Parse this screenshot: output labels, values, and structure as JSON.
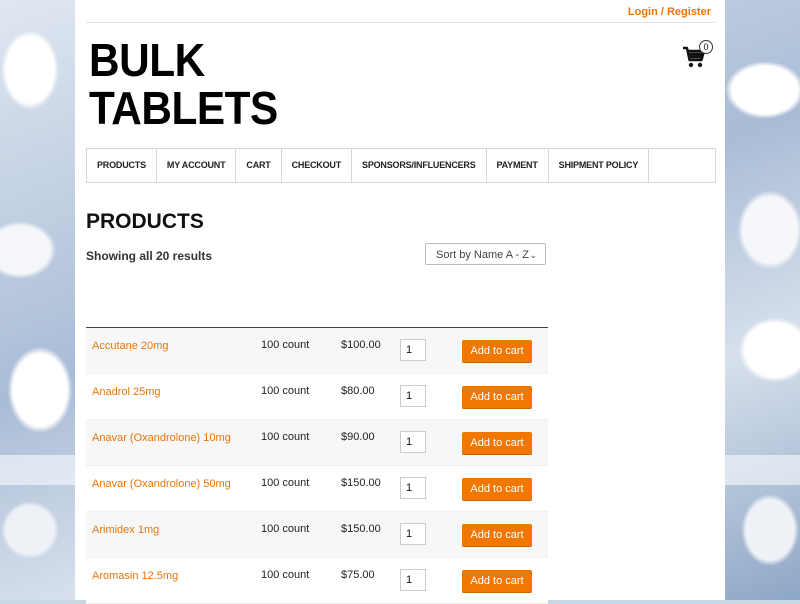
{
  "header": {
    "login_label": "Login / Register",
    "logo_line1": "BULK",
    "logo_line2": "TABLETS",
    "cart_count": "0"
  },
  "nav": {
    "items": [
      {
        "label": "PRODUCTS"
      },
      {
        "label": "MY ACCOUNT"
      },
      {
        "label": "CART"
      },
      {
        "label": "CHECKOUT"
      },
      {
        "label": "SPONSORS/INFLUENCERS"
      },
      {
        "label": "PAYMENT"
      },
      {
        "label": "SHIPMENT POLICY"
      }
    ]
  },
  "main": {
    "title": "PRODUCTS",
    "result_count": "Showing all 20 results",
    "sort_selected": "Sort by Name A - Z"
  },
  "products": {
    "add_label": "Add to cart",
    "rows": [
      {
        "name": "Accutane 20mg",
        "count": "100 count",
        "price": "$100.00",
        "qty": "1"
      },
      {
        "name": "Anadrol 25mg",
        "count": "100 count",
        "price": "$80.00",
        "qty": "1"
      },
      {
        "name": "Anavar (Oxandrolone) 10mg",
        "count": "100 count",
        "price": "$90.00",
        "qty": "1"
      },
      {
        "name": "Anavar (Oxandrolone) 50mg",
        "count": "100 count",
        "price": "$150.00",
        "qty": "1"
      },
      {
        "name": "Arimidex 1mg",
        "count": "100 count",
        "price": "$150.00",
        "qty": "1"
      },
      {
        "name": "Aromasin 12.5mg",
        "count": "100 count",
        "price": "$75.00",
        "qty": "1"
      }
    ]
  },
  "colors": {
    "accent": "#e8750a",
    "button": "#f07800"
  }
}
